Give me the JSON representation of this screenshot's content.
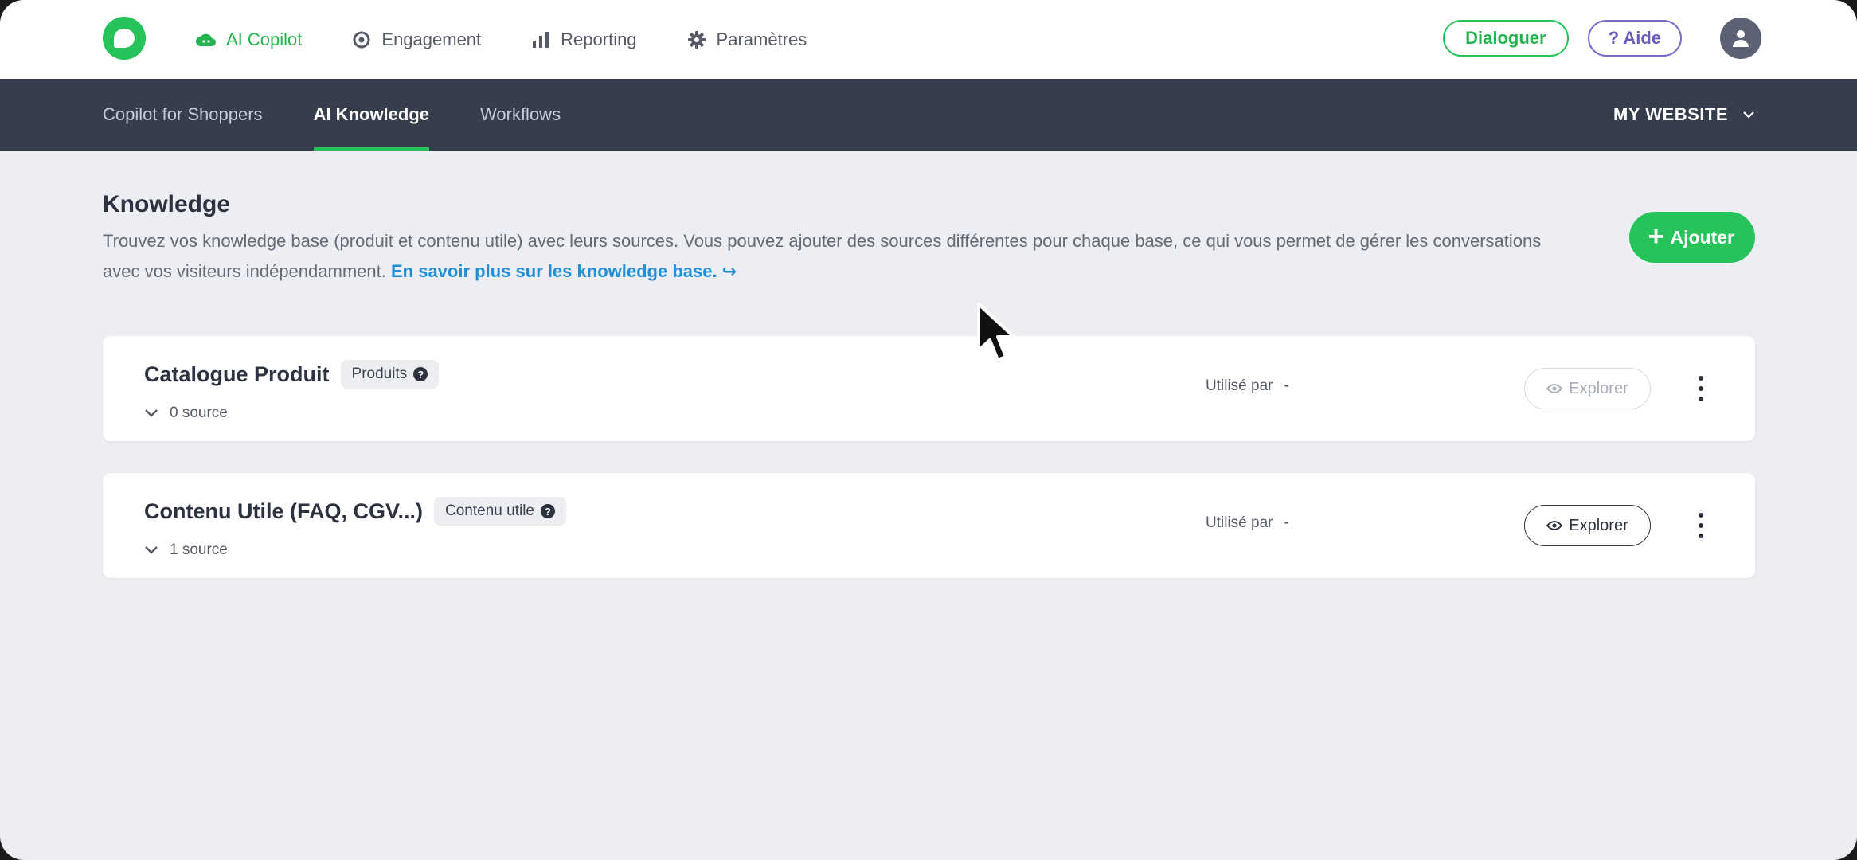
{
  "topbar": {
    "nav": [
      {
        "label": "AI Copilot",
        "icon": "cloud-icon",
        "active": true
      },
      {
        "label": "Engagement",
        "icon": "target-icon",
        "active": false
      },
      {
        "label": "Reporting",
        "icon": "bar-chart-icon",
        "active": false
      },
      {
        "label": "Paramètres",
        "icon": "gear-icon",
        "active": false
      }
    ],
    "dialoguer_label": "Dialoguer",
    "aide_label": "? Aide"
  },
  "subnav": {
    "tabs": [
      {
        "label": "Copilot for Shoppers",
        "active": false
      },
      {
        "label": "AI Knowledge",
        "active": true
      },
      {
        "label": "Workflows",
        "active": false
      }
    ],
    "site_label": "MY WEBSITE"
  },
  "knowledge": {
    "title": "Knowledge",
    "description": "Trouvez vos knowledge base (produit et contenu utile) avec leurs sources. Vous pouvez ajouter des sources différentes pour chaque base, ce qui vous permet de gérer les conversations avec vos visiteurs indépendamment.",
    "link_label": "En savoir plus sur les knowledge base. ↪",
    "add_label": "Ajouter",
    "bases": [
      {
        "name": "Catalogue Produit",
        "tag": "Produits",
        "sources": "0 source",
        "used_by_label": "Utilisé par",
        "used_by_value": "-",
        "explore_label": "Explorer",
        "explore_enabled": false
      },
      {
        "name": "Contenu Utile (FAQ, CGV...)",
        "tag": "Contenu utile",
        "sources": "1 source",
        "used_by_label": "Utilisé par",
        "used_by_value": "-",
        "explore_label": "Explorer",
        "explore_enabled": true
      }
    ]
  },
  "colors": {
    "brand_green": "#25c35a",
    "link_blue": "#1f8fd6",
    "subnav_bg": "#363d4c",
    "aide_purple": "#6b5bb9"
  }
}
